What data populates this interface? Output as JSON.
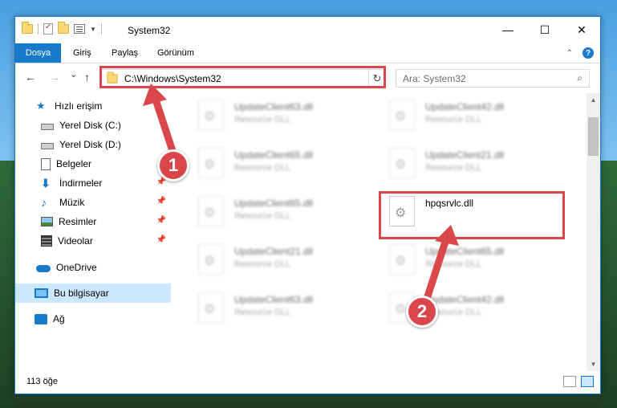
{
  "window": {
    "title": "System32",
    "minimize": "—",
    "maximize": "☐",
    "close": "✕"
  },
  "ribbon": {
    "tabs": [
      {
        "label": "Dosya"
      },
      {
        "label": "Giriş"
      },
      {
        "label": "Paylaş"
      },
      {
        "label": "Görünüm"
      }
    ],
    "help": "?"
  },
  "nav": {
    "back": "←",
    "forward": "→",
    "recent": "⌄",
    "up": "↑",
    "address": "C:\\Windows\\System32",
    "search_placeholder": "Ara: System32"
  },
  "sidebar": {
    "items": [
      {
        "label": "Hızlı erişim",
        "icon": "star-icon"
      },
      {
        "label": "Yerel Disk (C:)",
        "icon": "disk-icon",
        "pinned": true
      },
      {
        "label": "Yerel Disk (D:)",
        "icon": "disk-icon",
        "pinned": true
      },
      {
        "label": "Belgeler",
        "icon": "document-icon",
        "pinned": true
      },
      {
        "label": "İndirmeler",
        "icon": "download-icon",
        "pinned": true
      },
      {
        "label": "Müzik",
        "icon": "music-icon",
        "pinned": true
      },
      {
        "label": "Resimler",
        "icon": "picture-icon",
        "pinned": true
      },
      {
        "label": "Videolar",
        "icon": "video-icon",
        "pinned": true
      },
      {
        "label": "OneDrive",
        "icon": "cloud-icon"
      },
      {
        "label": "Bu bilgisayar",
        "icon": "computer-icon",
        "selected": true
      },
      {
        "label": "Ağ",
        "icon": "network-icon"
      }
    ]
  },
  "files": [
    {
      "name": "UpdateClient63.dll",
      "type": "Resource DLL",
      "blurred": true
    },
    {
      "name": "UpdateClient42.dll",
      "type": "Resource DLL",
      "blurred": true
    },
    {
      "name": "UpdateClient65.dll",
      "type": "Resource DLL",
      "blurred": true
    },
    {
      "name": "UpdateClient21.dll",
      "type": "Resource DLL",
      "blurred": true
    },
    {
      "name": "UpdateClient65.dll",
      "type": "Resource DLL",
      "blurred": true
    },
    {
      "name": "hpqsrvlc.dll",
      "type": "",
      "blurred": false
    },
    {
      "name": "UpdateClient21.dll",
      "type": "Resource DLL",
      "blurred": true
    },
    {
      "name": "UpdateClient65.dll",
      "type": "Resource DLL",
      "blurred": true
    },
    {
      "name": "UpdateClient63.dll",
      "type": "Resource DLL",
      "blurred": true
    },
    {
      "name": "UpdateClient42.dll",
      "type": "Resource DLL",
      "blurred": true
    }
  ],
  "status": {
    "count": "113 öğe"
  },
  "annotations": {
    "step1": "1",
    "step2": "2",
    "color": "#d9474b"
  }
}
